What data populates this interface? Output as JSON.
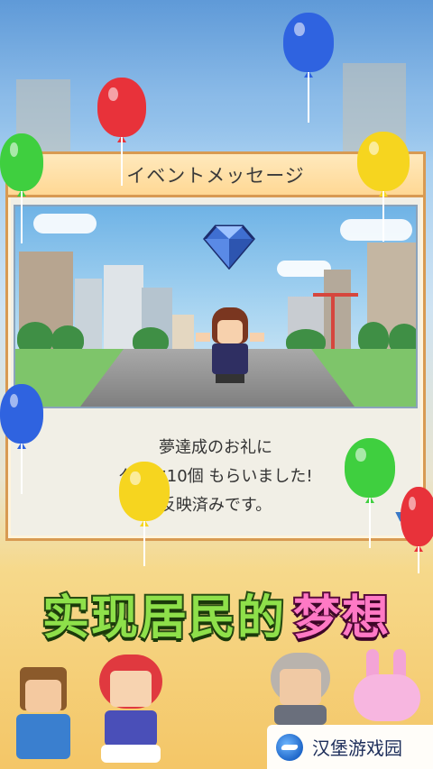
{
  "dialog": {
    "title": "イベントメッセージ",
    "message_lines": [
      "夢達成のお礼に",
      "ダイヤ10個 もらいました!",
      "反映済みです。"
    ],
    "more_indicator": "▼"
  },
  "banner": {
    "main_text": "实现居民的",
    "accent_text": "梦想"
  },
  "watermark": {
    "text": "汉堡游戏园"
  },
  "colors": {
    "balloon_red": "#e8323a",
    "balloon_blue": "#2f63e0",
    "balloon_green": "#3fcf3f",
    "balloon_yellow": "#f6d51f",
    "dialog_border": "#d89a52",
    "banner_green": "#8ee04a",
    "banner_pink": "#ff79c5"
  },
  "icons": [
    "diamond-icon",
    "balloon-icon",
    "more-arrow-icon"
  ]
}
